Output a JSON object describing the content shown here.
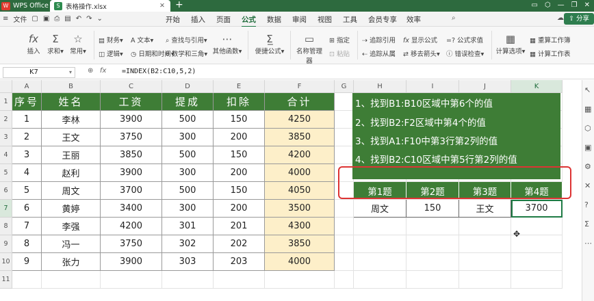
{
  "titlebar": {
    "app_name": "WPS Office",
    "doc_tab": "表格操作.xlsx"
  },
  "menu": {
    "file": "文件"
  },
  "ribbon_tabs": [
    "开始",
    "插入",
    "页面",
    "公式",
    "数据",
    "审阅",
    "视图",
    "工具",
    "会员专享",
    "效率"
  ],
  "share": "分享",
  "toolbar": {
    "insert_fn": "插入",
    "sum": "求和",
    "common": "常用",
    "finance": "财务",
    "logic": "逻辑",
    "text": "文本",
    "datetime": "日期和时间",
    "lookup": "查找与引用",
    "math": "数学和三角",
    "other": "其他函数",
    "convenience": "便捷公式",
    "name_mgr": "名称管理器",
    "specify": "指定",
    "paste": "粘贴",
    "trace_prec": "追踪引用",
    "trace_dep": "追踪从属",
    "show_formula": "显示公式",
    "remove_arrow": "移去箭头",
    "eval": "公式求值",
    "err_check": "错误检查",
    "calc_opts": "计算选项",
    "recalc": "重算工作簿",
    "calc_sheet": "计算工作表"
  },
  "formula_bar": {
    "cell_ref": "K7",
    "formula": "=INDEX(B2:C10,5,2)"
  },
  "columns": [
    "A",
    "B",
    "C",
    "D",
    "E",
    "F",
    "G",
    "H",
    "I",
    "J",
    "K"
  ],
  "rows": [
    "1",
    "2",
    "3",
    "4",
    "5",
    "6",
    "7",
    "8",
    "9",
    "10",
    "11"
  ],
  "table": {
    "headers": [
      "序号",
      "姓名",
      "工资",
      "提成",
      "扣除",
      "合计"
    ],
    "data": [
      [
        "1",
        "李林",
        "3900",
        "500",
        "150",
        "4250"
      ],
      [
        "2",
        "王文",
        "3750",
        "300",
        "200",
        "3850"
      ],
      [
        "3",
        "王丽",
        "3850",
        "500",
        "150",
        "4200"
      ],
      [
        "4",
        "赵利",
        "3900",
        "300",
        "200",
        "4000"
      ],
      [
        "5",
        "周文",
        "3700",
        "500",
        "150",
        "4050"
      ],
      [
        "6",
        "黄婷",
        "3400",
        "300",
        "200",
        "3500"
      ],
      [
        "7",
        "李强",
        "4200",
        "301",
        "201",
        "4300"
      ],
      [
        "8",
        "冯一",
        "3750",
        "302",
        "202",
        "3850"
      ],
      [
        "9",
        "张力",
        "3900",
        "303",
        "203",
        "4000"
      ]
    ]
  },
  "questions": [
    "1、找到B1:B10区域中第6个的值",
    "2、找到B2:F2区域中第4个的值",
    "3、找到A1:F10中第3行第2列的值",
    "4、找到B2:C10区域中第5行第2列的值"
  ],
  "answers": {
    "headers": [
      "第1题",
      "第2题",
      "第3题",
      "第4题"
    ],
    "values": [
      "周文",
      "150",
      "王文",
      "3700"
    ]
  },
  "colors": {
    "header_green": "#3e7d36",
    "total_yellow": "#fdefc9",
    "highlight_red": "#d33"
  }
}
